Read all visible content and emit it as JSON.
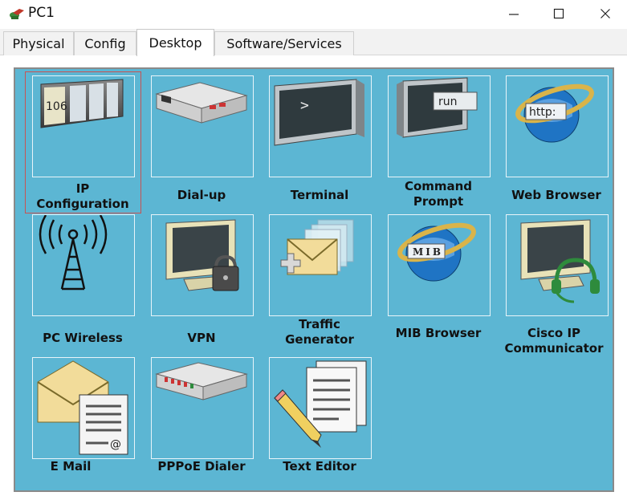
{
  "window": {
    "title": "PC1",
    "controls": {
      "minimize": "—",
      "maximize": "☐",
      "close": "✕"
    }
  },
  "tabs": [
    {
      "label": "Physical",
      "active": false
    },
    {
      "label": "Config",
      "active": false
    },
    {
      "label": "Desktop",
      "active": true
    },
    {
      "label": "Software/Services",
      "active": false
    }
  ],
  "desktop": {
    "background_color": "#5cb6d3",
    "apps": [
      {
        "label_lines": [
          "IP",
          "Configuration"
        ],
        "icon": "ip-configuration-icon",
        "icon_text": "106",
        "selected": true
      },
      {
        "label_lines": [
          "Dial-up"
        ],
        "icon": "modem-icon"
      },
      {
        "label_lines": [
          "Terminal"
        ],
        "icon": "terminal-icon",
        "icon_text": ">"
      },
      {
        "label_lines": [
          "Command",
          "Prompt"
        ],
        "icon": "command-prompt-icon",
        "icon_text": "run"
      },
      {
        "label_lines": [
          "Web Browser"
        ],
        "icon": "web-browser-icon",
        "icon_text": "http:"
      },
      {
        "label_lines": [
          "PC Wireless"
        ],
        "icon": "wireless-antenna-icon"
      },
      {
        "label_lines": [
          "VPN"
        ],
        "icon": "vpn-lock-icon"
      },
      {
        "label_lines": [
          "Traffic",
          "Generator"
        ],
        "icon": "traffic-generator-icon"
      },
      {
        "label_lines": [
          "MIB Browser"
        ],
        "icon": "mib-browser-icon",
        "icon_text": "MIB"
      },
      {
        "label_lines": [
          "Cisco IP",
          "Communicator"
        ],
        "icon": "ip-communicator-headset-icon"
      },
      {
        "label_lines": [
          "E Mail"
        ],
        "icon": "email-icon",
        "icon_text": "@"
      },
      {
        "label_lines": [
          "PPPoE Dialer"
        ],
        "icon": "pppoe-dialer-icon"
      },
      {
        "label_lines": [
          "Text Editor"
        ],
        "icon": "text-editor-icon"
      }
    ]
  }
}
